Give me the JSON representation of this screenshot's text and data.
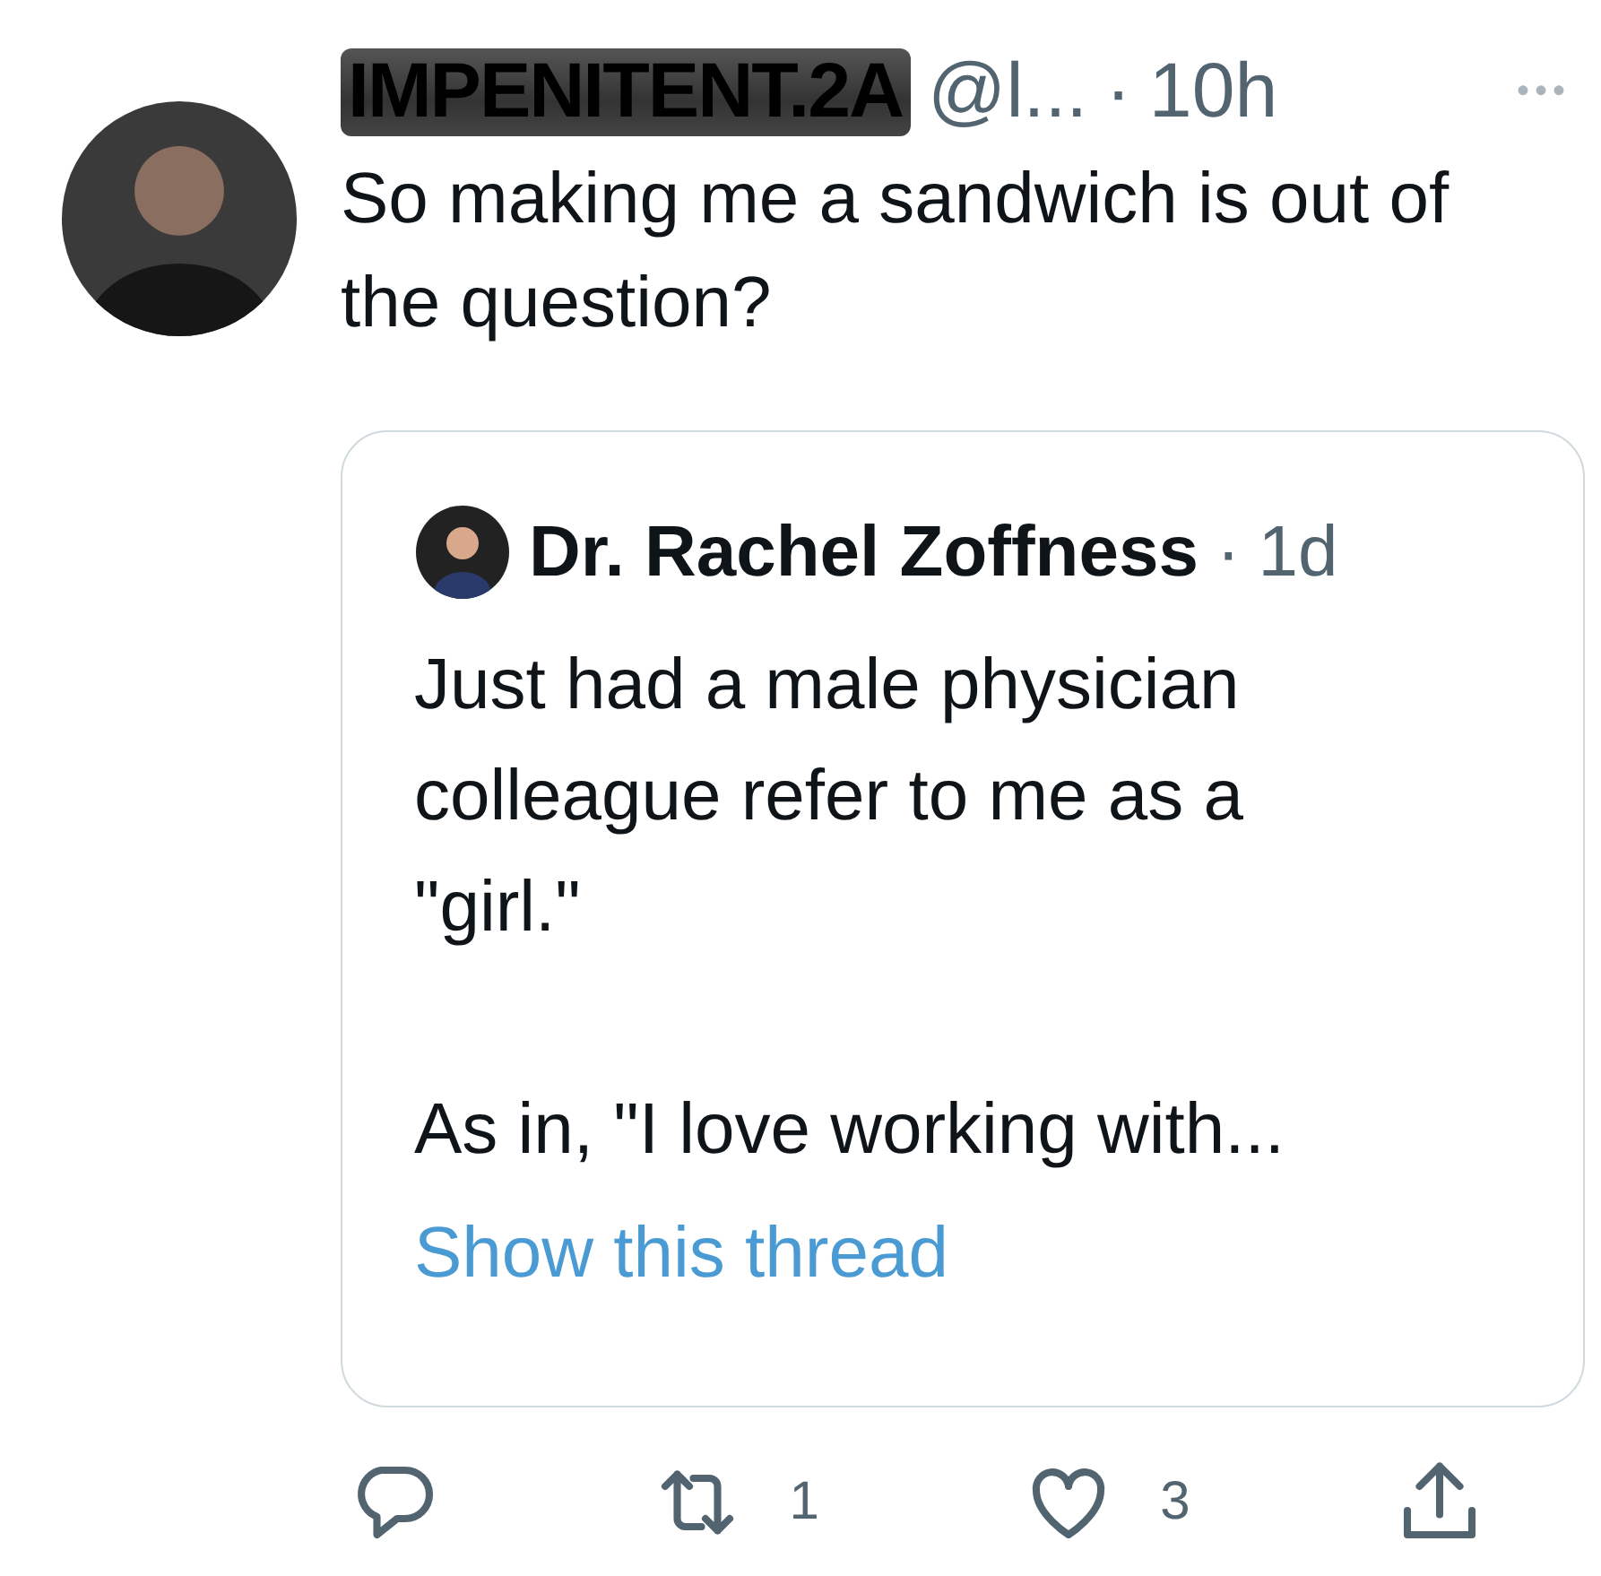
{
  "tweet": {
    "display_name": "IMPENITENT.2A",
    "redacted": true,
    "handle": "@l...",
    "separator": "·",
    "time": "10h",
    "more": "•••",
    "text": "So making me a sandwich is out of the question?"
  },
  "quote": {
    "author": "Dr. Rachel Zoffness",
    "separator": "·",
    "time": "1d",
    "paragraphs": [
      [
        "Just had a male physician",
        "colleague refer to me as a",
        "\"girl.\""
      ],
      [
        "As in, \"I love working with..."
      ]
    ],
    "link": "Show this thread"
  },
  "actions": [
    {
      "kind": "reply"
    },
    {
      "kind": "retweet",
      "count": "1"
    },
    {
      "kind": "like",
      "count": "3"
    },
    {
      "kind": "share"
    }
  ]
}
